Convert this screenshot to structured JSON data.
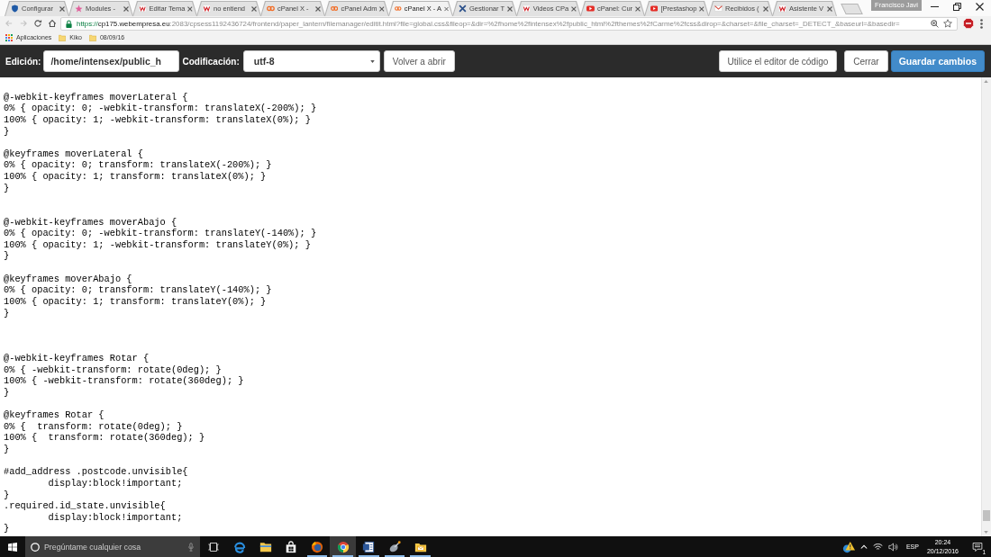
{
  "browser": {
    "tabs": [
      {
        "title": "Configurar",
        "kind": "shield",
        "selected": false
      },
      {
        "title": "Modules -",
        "kind": "star",
        "selected": false
      },
      {
        "title": "Editar Tema",
        "kind": "zigzag",
        "selected": false
      },
      {
        "title": "no entiend",
        "kind": "zigzag",
        "selected": false
      },
      {
        "title": "cPanel X -",
        "kind": "rings",
        "selected": false
      },
      {
        "title": "cPanel Adm",
        "kind": "rings",
        "selected": false
      },
      {
        "title": "cPanel X - A",
        "kind": "rings",
        "selected": true
      },
      {
        "title": "Gestionar T",
        "kind": "cross",
        "selected": false
      },
      {
        "title": "Videos CPa",
        "kind": "zigzag",
        "selected": false
      },
      {
        "title": "cPanel: Cur",
        "kind": "play",
        "selected": false
      },
      {
        "title": "[Prestashop",
        "kind": "play",
        "selected": false
      },
      {
        "title": "Recibidos (",
        "kind": "envelope",
        "selected": false
      },
      {
        "title": "Asistente V",
        "kind": "zigzag",
        "selected": false
      }
    ],
    "profile": {
      "name": "Francisco Javi"
    },
    "navigation": [
      {
        "kind": "back",
        "disabled": true
      },
      {
        "kind": "forward",
        "disabled": true
      },
      {
        "kind": "reload",
        "disabled": false
      },
      {
        "kind": "home",
        "disabled": false
      }
    ],
    "address": {
      "scheme": "https://",
      "host": "cp175.webempresa.eu",
      "path": ":2083/cpsess1192436724/frontend/paper_lantern/filemanager/editit.html?file=global.css&fileop=&dir=%2fhome%2fintensex%2fpublic_html%2fthemes%2fCarme%2fcss&dirop=&charset=&file_charset=_DETECT_&baseurl=&basedir="
    },
    "bookmarks": [
      {
        "label": "Aplicaciones",
        "kind": "apps"
      },
      {
        "label": "Kiko",
        "kind": "folder"
      },
      {
        "label": "08/09/16",
        "kind": "folder"
      }
    ]
  },
  "file_toolbar": {
    "path_label": "Edición:",
    "path_field": {
      "value": "/home/intensex/public_h"
    },
    "encoding_label": "Codificación:",
    "encoding_select": {
      "value": "utf-8"
    },
    "left_buttons": [
      {
        "label": "Volver a abrir",
        "kind": "default"
      }
    ],
    "right_buttons": [
      {
        "label": "Utilice el editor de código",
        "kind": "default"
      },
      {
        "label": "Cerrar",
        "kind": "default"
      },
      {
        "label": "Guardar cambios",
        "kind": "primary"
      }
    ]
  },
  "editor": {
    "text": "@-webkit-keyframes moverLateral {\n0% { opacity: 0; -webkit-transform: translateX(-200%); }\n100% { opacity: 1; -webkit-transform: translateX(0%); }\n}\n\n@keyframes moverLateral {\n0% { opacity: 0; transform: translateX(-200%); }\n100% { opacity: 1; transform: translateX(0%); }\n}\n\n\n@-webkit-keyframes moverAbajo {\n0% { opacity: 0; -webkit-transform: translateY(-140%); }\n100% { opacity: 1; -webkit-transform: translateY(0%); }\n}\n\n@keyframes moverAbajo {\n0% { opacity: 0; transform: translateY(-140%); }\n100% { opacity: 1; transform: translateY(0%); }\n}\n\n\n\n@-webkit-keyframes Rotar {\n0% { -webkit-transform: rotate(0deg); }\n100% { -webkit-transform: rotate(360deg); }\n}\n\n@keyframes Rotar {\n0% {  transform: rotate(0deg); }\n100% {  transform: rotate(360deg); }\n}\n\n#add_address .postcode.unvisible{\n\tdisplay:block!important;\n}\n.required.id_state.unvisible{\n\tdisplay:block!important;\n}"
  },
  "taskbar": {
    "search": {
      "placeholder": "Pregúntame cualquier cosa"
    },
    "apps": [
      {
        "kind": "swirl",
        "open": false,
        "selected": false
      },
      {
        "kind": "folder",
        "open": false,
        "selected": false
      },
      {
        "kind": "bag",
        "open": false,
        "selected": false
      },
      {
        "kind": "globe",
        "open": true,
        "selected": false
      },
      {
        "kind": "segmented-circle",
        "open": true,
        "selected": true
      },
      {
        "kind": "document",
        "open": true,
        "selected": false
      },
      {
        "kind": "dish",
        "open": true,
        "selected": false
      },
      {
        "kind": "mail-folder",
        "open": true,
        "selected": false
      }
    ],
    "tray": {
      "language": "ESP",
      "time": "20:24",
      "date": "20/12/2016",
      "notification_count": "1"
    }
  }
}
